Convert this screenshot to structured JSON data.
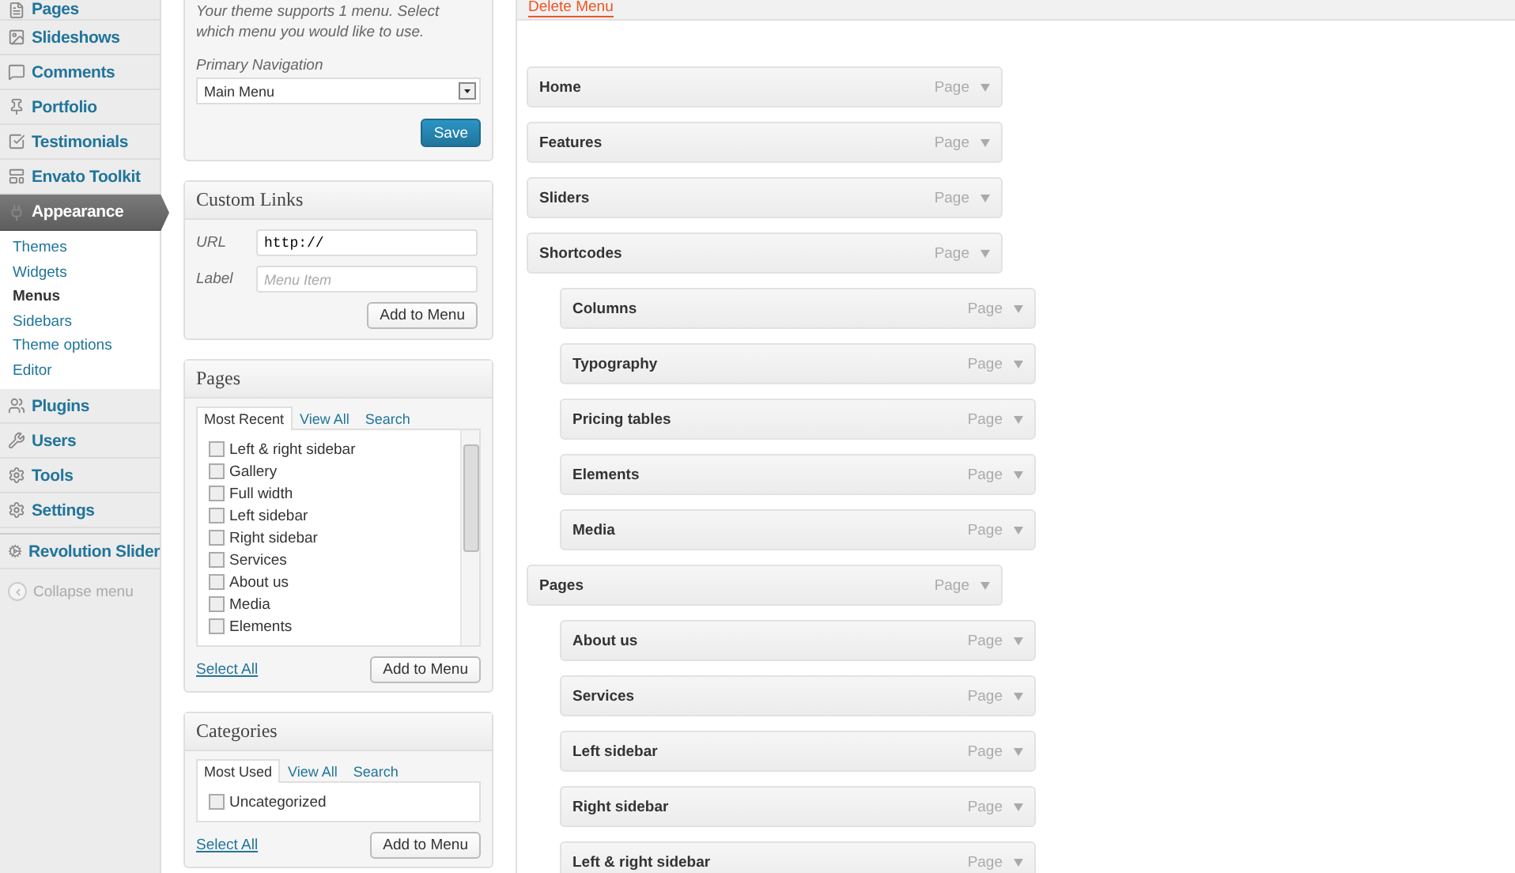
{
  "sidebar": {
    "items": [
      {
        "label": "Pages",
        "selected": false
      },
      {
        "label": "Slideshows",
        "selected": false
      },
      {
        "label": "Comments",
        "selected": false
      },
      {
        "label": "Portfolio",
        "selected": false
      },
      {
        "label": "Testimonials",
        "selected": false
      },
      {
        "label": "Envato Toolkit",
        "selected": false
      },
      {
        "label": "Appearance",
        "selected": true,
        "children": [
          {
            "label": "Themes",
            "selected": false
          },
          {
            "label": "Widgets",
            "selected": false
          },
          {
            "label": "Menus",
            "selected": true
          },
          {
            "label": "Sidebars",
            "selected": false
          },
          {
            "label": "Theme options",
            "selected": false
          },
          {
            "label": "Editor",
            "selected": false
          }
        ]
      },
      {
        "label": "Plugins",
        "selected": false
      },
      {
        "label": "Users",
        "selected": false
      },
      {
        "label": "Tools",
        "selected": false
      },
      {
        "label": "Settings",
        "selected": false
      },
      {
        "label": "Revolution Slider",
        "selected": false
      }
    ],
    "collapse": "Collapse menu"
  },
  "theme_locations": {
    "note": "Your theme supports 1 menu. Select which menu you would like to use.",
    "select_label": "Primary Navigation",
    "select_value": "Main Menu",
    "button": "Save"
  },
  "custom_links": {
    "title": "Custom Links",
    "fields": [
      {
        "label": "URL",
        "value": "http://"
      },
      {
        "label": "Label",
        "placeholder": "Menu Item"
      }
    ],
    "button": "Add to Menu"
  },
  "pages": {
    "title": "Pages",
    "tabs": [
      {
        "label": "Most Recent",
        "selected": true
      },
      {
        "label": "View All",
        "selected": false
      },
      {
        "label": "Search",
        "selected": false
      }
    ],
    "items": [
      {
        "label": "Left & right sidebar",
        "checked": false
      },
      {
        "label": "Gallery",
        "checked": false
      },
      {
        "label": "Full width",
        "checked": false
      },
      {
        "label": "Left sidebar",
        "checked": false
      },
      {
        "label": "Right sidebar",
        "checked": false
      },
      {
        "label": "Services",
        "checked": false
      },
      {
        "label": "About us",
        "checked": false
      },
      {
        "label": "Media",
        "checked": false
      },
      {
        "label": "Elements",
        "checked": false
      }
    ],
    "select_all": "Select All",
    "button": "Add to Menu"
  },
  "categories": {
    "title": "Categories",
    "tabs": [
      {
        "label": "Most Used",
        "selected": true
      },
      {
        "label": "View All",
        "selected": false
      },
      {
        "label": "Search",
        "selected": false
      }
    ],
    "items": [
      {
        "label": "Uncategorized",
        "checked": false
      }
    ],
    "select_all": "Select All",
    "button": "Add to Menu"
  },
  "menu_editor": {
    "delete_link": "Delete Menu",
    "items": [
      {
        "label": "Home",
        "type": "Page"
      },
      {
        "label": "Features",
        "type": "Page"
      },
      {
        "label": "Sliders",
        "type": "Page"
      },
      {
        "label": "Shortcodes",
        "type": "Page",
        "children": [
          {
            "label": "Columns",
            "type": "Page"
          },
          {
            "label": "Typography",
            "type": "Page"
          },
          {
            "label": "Pricing tables",
            "type": "Page"
          },
          {
            "label": "Elements",
            "type": "Page"
          },
          {
            "label": "Media",
            "type": "Page"
          }
        ]
      },
      {
        "label": "Pages",
        "type": "Page",
        "children": [
          {
            "label": "About us",
            "type": "Page"
          },
          {
            "label": "Services",
            "type": "Page"
          },
          {
            "label": "Left sidebar",
            "type": "Page"
          },
          {
            "label": "Right sidebar",
            "type": "Page"
          },
          {
            "label": "Left & right sidebar",
            "type": "Page"
          }
        ]
      }
    ]
  }
}
